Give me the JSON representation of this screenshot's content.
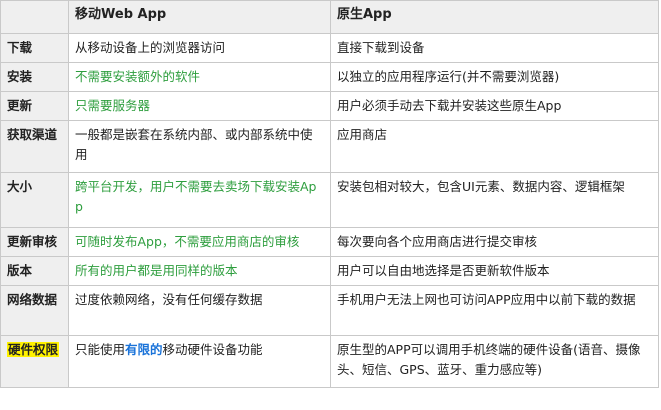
{
  "table": {
    "headers": [
      "",
      "移动Web App",
      "原生App"
    ],
    "rows": [
      {
        "label": "下载",
        "web": "从移动设备上的浏览器访问",
        "web_color": "normal",
        "native": "直接下载到设备"
      },
      {
        "label": "安装",
        "web": "不需要安装额外的软件",
        "web_color": "green",
        "native": "以独立的应用程序运行(并不需要浏览器)"
      },
      {
        "label": "更新",
        "web": "只需要服务器",
        "web_color": "green",
        "native": "用户必须手动去下载并安装这些原生App"
      },
      {
        "label": "获取渠道",
        "web": "一般都是嵌套在系统内部、或内部系统中使用",
        "web_color": "normal",
        "native": "应用商店"
      },
      {
        "label": "大小",
        "web": "跨平台开发，用户不需要去卖场下载安装App",
        "web_color": "green",
        "native": "安装包相对较大，包含UI元素、数据内容、逻辑框架"
      },
      {
        "label": "更新审核",
        "web": "可随时发布App，不需要应用商店的审核",
        "web_color": "green",
        "native": "每次要向各个应用商店进行提交审核"
      },
      {
        "label": "版本",
        "web": "所有的用户都是用同样的版本",
        "web_color": "green",
        "native": "用户可以自由地选择是否更新软件版本"
      },
      {
        "label": "网络数据",
        "web": "过度依赖网络，没有任何缓存数据",
        "web_color": "normal",
        "native": "手机用户无法上网也可访问APP应用中以前下载的数据"
      },
      {
        "label": "硬件权限",
        "label_highlight": true,
        "web_prefix": "只能使用",
        "web_emph": "有限的",
        "web_suffix": "移动硬件设备功能",
        "native": "原生型的APP可以调用手机终端的硬件设备(语音、摄像头、短信、GPS、蓝牙、重力感应等)"
      }
    ]
  },
  "colors": {
    "green_text": "#2e9e3e",
    "blue_text": "#1a73d9",
    "highlight": "#fff200",
    "header_bg": "#efefef",
    "border": "#c9c9c9"
  }
}
